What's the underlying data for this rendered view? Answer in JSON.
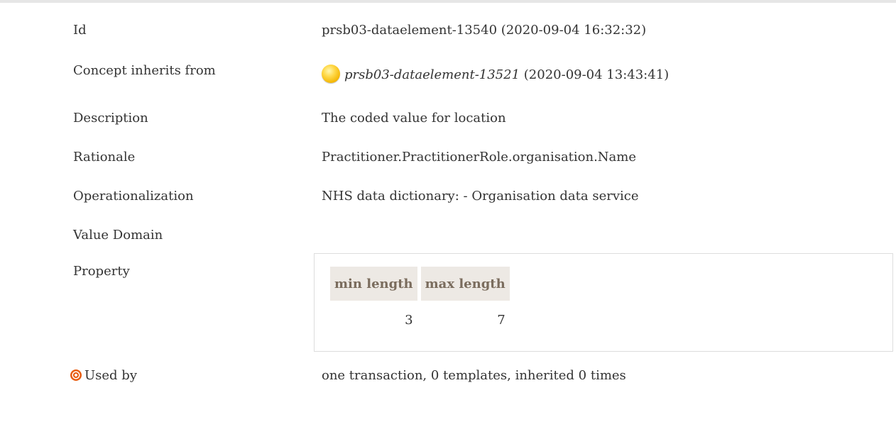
{
  "fields": {
    "id": {
      "label": "Id",
      "value": "prsb03-dataelement-13540 (2020-09-04 16:32:32)"
    },
    "concept_inherits_from": {
      "label": "Concept inherits from",
      "ref": "prsb03-dataelement-13521",
      "date": "(2020-09-04 13:43:41)",
      "icon": "yellow-circle-icon"
    },
    "description": {
      "label": "Description",
      "value": "The coded value for location"
    },
    "rationale": {
      "label": "Rationale",
      "value": "Practitioner.PractitionerRole.organisation.Name"
    },
    "operationalization": {
      "label": "Operationalization",
      "value": "NHS data dictionary: - Organisation data service"
    },
    "value_domain": {
      "label": "Value Domain"
    },
    "property": {
      "label": "Property",
      "headers": [
        "min length",
        "max length"
      ],
      "values": [
        "3",
        "7"
      ]
    },
    "used_by": {
      "label": "Used by",
      "icon": "target-icon",
      "value": "one transaction, 0 templates, inherited 0 times"
    }
  },
  "colors": {
    "header_bg": "#ede9e4",
    "header_text": "#7a6c5d",
    "icon_yellow": "#f3b400",
    "icon_target": "#e85d10"
  }
}
